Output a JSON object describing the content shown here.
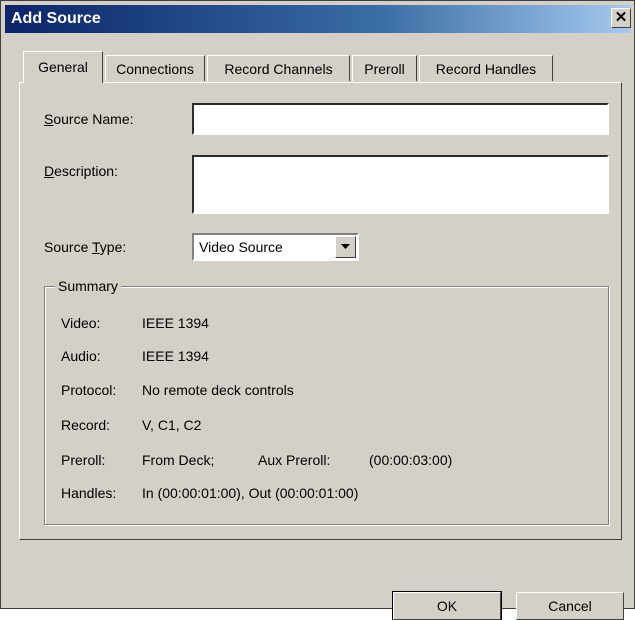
{
  "window": {
    "title": "Add Source",
    "close_glyph": "✕"
  },
  "tabs": [
    {
      "label": "General"
    },
    {
      "label": "Connections"
    },
    {
      "label": "Record Channels"
    },
    {
      "label": "Preroll"
    },
    {
      "label": "Record Handles"
    }
  ],
  "form": {
    "source_name": {
      "label_mnemonic": "S",
      "label_rest": "ource Name:",
      "value": ""
    },
    "description": {
      "label_mnemonic": "D",
      "label_rest": "escription:",
      "value": ""
    },
    "source_type": {
      "label_prefix": "Source ",
      "label_mnemonic": "T",
      "label_rest": "ype:",
      "value": "Video Source"
    }
  },
  "summary": {
    "title": "Summary",
    "rows": [
      {
        "label": "Video:",
        "value": "IEEE 1394"
      },
      {
        "label": "Audio:",
        "value": "IEEE 1394"
      },
      {
        "label": "Protocol:",
        "value": "No remote deck controls"
      },
      {
        "label": "Record:",
        "value": "V, C1, C2"
      },
      {
        "label": "Preroll:",
        "value": "From Deck;",
        "extra_label": "Aux Preroll:",
        "extra_value": "(00:00:03:00)"
      },
      {
        "label": "Handles:",
        "value": "In  (00:00:01:00), Out (00:00:01:00)"
      }
    ]
  },
  "buttons": {
    "ok": "OK",
    "cancel": "Cancel"
  }
}
